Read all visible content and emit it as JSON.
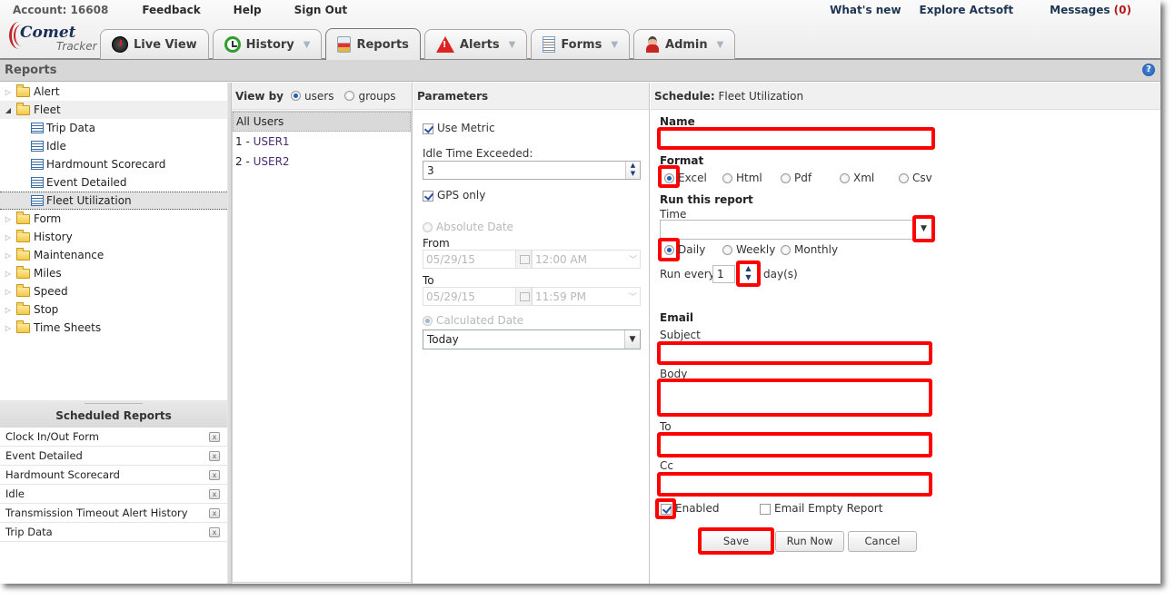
{
  "header": {
    "account_label": "Account: 16608",
    "links": [
      "Feedback",
      "Help",
      "Sign Out"
    ],
    "right_links": {
      "whats_new": "What's new",
      "explore": "Explore Actsoft",
      "messages_label": "Messages",
      "messages_count": "(0)"
    },
    "logo": {
      "brand": "Comet",
      "sub": "Tracker"
    }
  },
  "tabs": [
    {
      "label": "Live View",
      "icon": "live-view-icon",
      "dropdown": false
    },
    {
      "label": "History",
      "icon": "history-clock-icon",
      "dropdown": true
    },
    {
      "label": "Reports",
      "icon": "reports-icon",
      "dropdown": false,
      "active": true
    },
    {
      "label": "Alerts",
      "icon": "alert-triangle-icon",
      "dropdown": true
    },
    {
      "label": "Forms",
      "icon": "forms-document-icon",
      "dropdown": true
    },
    {
      "label": "Admin",
      "icon": "admin-user-icon",
      "dropdown": true
    }
  ],
  "page": {
    "title": "Reports",
    "help_icon": "?"
  },
  "tree": {
    "folders": [
      {
        "label": "Alert",
        "expanded": false
      },
      {
        "label": "Fleet",
        "expanded": true,
        "children": [
          "Trip Data",
          "Idle",
          "Hardmount Scorecard",
          "Event Detailed",
          "Fleet Utilization"
        ],
        "selected_child": "Fleet Utilization"
      },
      {
        "label": "Form",
        "expanded": false
      },
      {
        "label": "History",
        "expanded": false
      },
      {
        "label": "Maintenance",
        "expanded": false
      },
      {
        "label": "Miles",
        "expanded": false
      },
      {
        "label": "Speed",
        "expanded": false
      },
      {
        "label": "Stop",
        "expanded": false
      },
      {
        "label": "Time Sheets",
        "expanded": false
      }
    ]
  },
  "scheduled_reports": {
    "title": "Scheduled Reports",
    "items": [
      "Clock In/Out Form",
      "Event Detailed",
      "Hardmount Scorecard",
      "Idle",
      "Transmission Timeout Alert History",
      "Trip Data"
    ],
    "remove_glyph": "x"
  },
  "users_pane": {
    "view_by_label": "View by",
    "options": [
      "users",
      "groups"
    ],
    "selected_option": "users",
    "rows": [
      {
        "num": "All Users",
        "name": ""
      },
      {
        "num": "1 - ",
        "name": "USER1"
      },
      {
        "num": "2 - ",
        "name": "USER2"
      }
    ]
  },
  "parameters": {
    "title": "Parameters",
    "use_metric": {
      "label": "Use Metric",
      "checked": true
    },
    "idle_time": {
      "label": "Idle Time Exceeded:",
      "value": "3"
    },
    "gps_only": {
      "label": "GPS only",
      "checked": true
    },
    "absolute_date": {
      "label": "Absolute Date",
      "selected": false
    },
    "from": {
      "label": "From",
      "date": "05/29/15",
      "time": "12:00 AM"
    },
    "to": {
      "label": "To",
      "date": "05/29/15",
      "time": "11:59 PM"
    },
    "calculated_date": {
      "label": "Calculated Date",
      "selected": true,
      "value": "Today"
    }
  },
  "schedule": {
    "title_prefix": "Schedule:",
    "title_report": "Fleet Utilization",
    "name_label": "Name",
    "name_value": "",
    "format_label": "Format",
    "formats": [
      "Excel",
      "Html",
      "Pdf",
      "Xml",
      "Csv"
    ],
    "selected_format": "Excel",
    "run_label": "Run this report",
    "time_label": "Time",
    "time_value": "",
    "frequencies": [
      "Daily",
      "Weekly",
      "Monthly"
    ],
    "selected_frequency": "Daily",
    "run_every_label": "Run every",
    "run_every_value": "1",
    "run_every_unit": "day(s)",
    "email_label": "Email",
    "subject_label": "Subject",
    "body_label": "Body",
    "to_label": "To",
    "cc_label": "Cc",
    "enabled": {
      "label": "Enabled",
      "checked": true
    },
    "email_empty": {
      "label": "Email Empty Report",
      "checked": false
    },
    "buttons": {
      "save": "Save",
      "run_now": "Run Now",
      "cancel": "Cancel"
    },
    "highlight_color": "#ff0000"
  }
}
